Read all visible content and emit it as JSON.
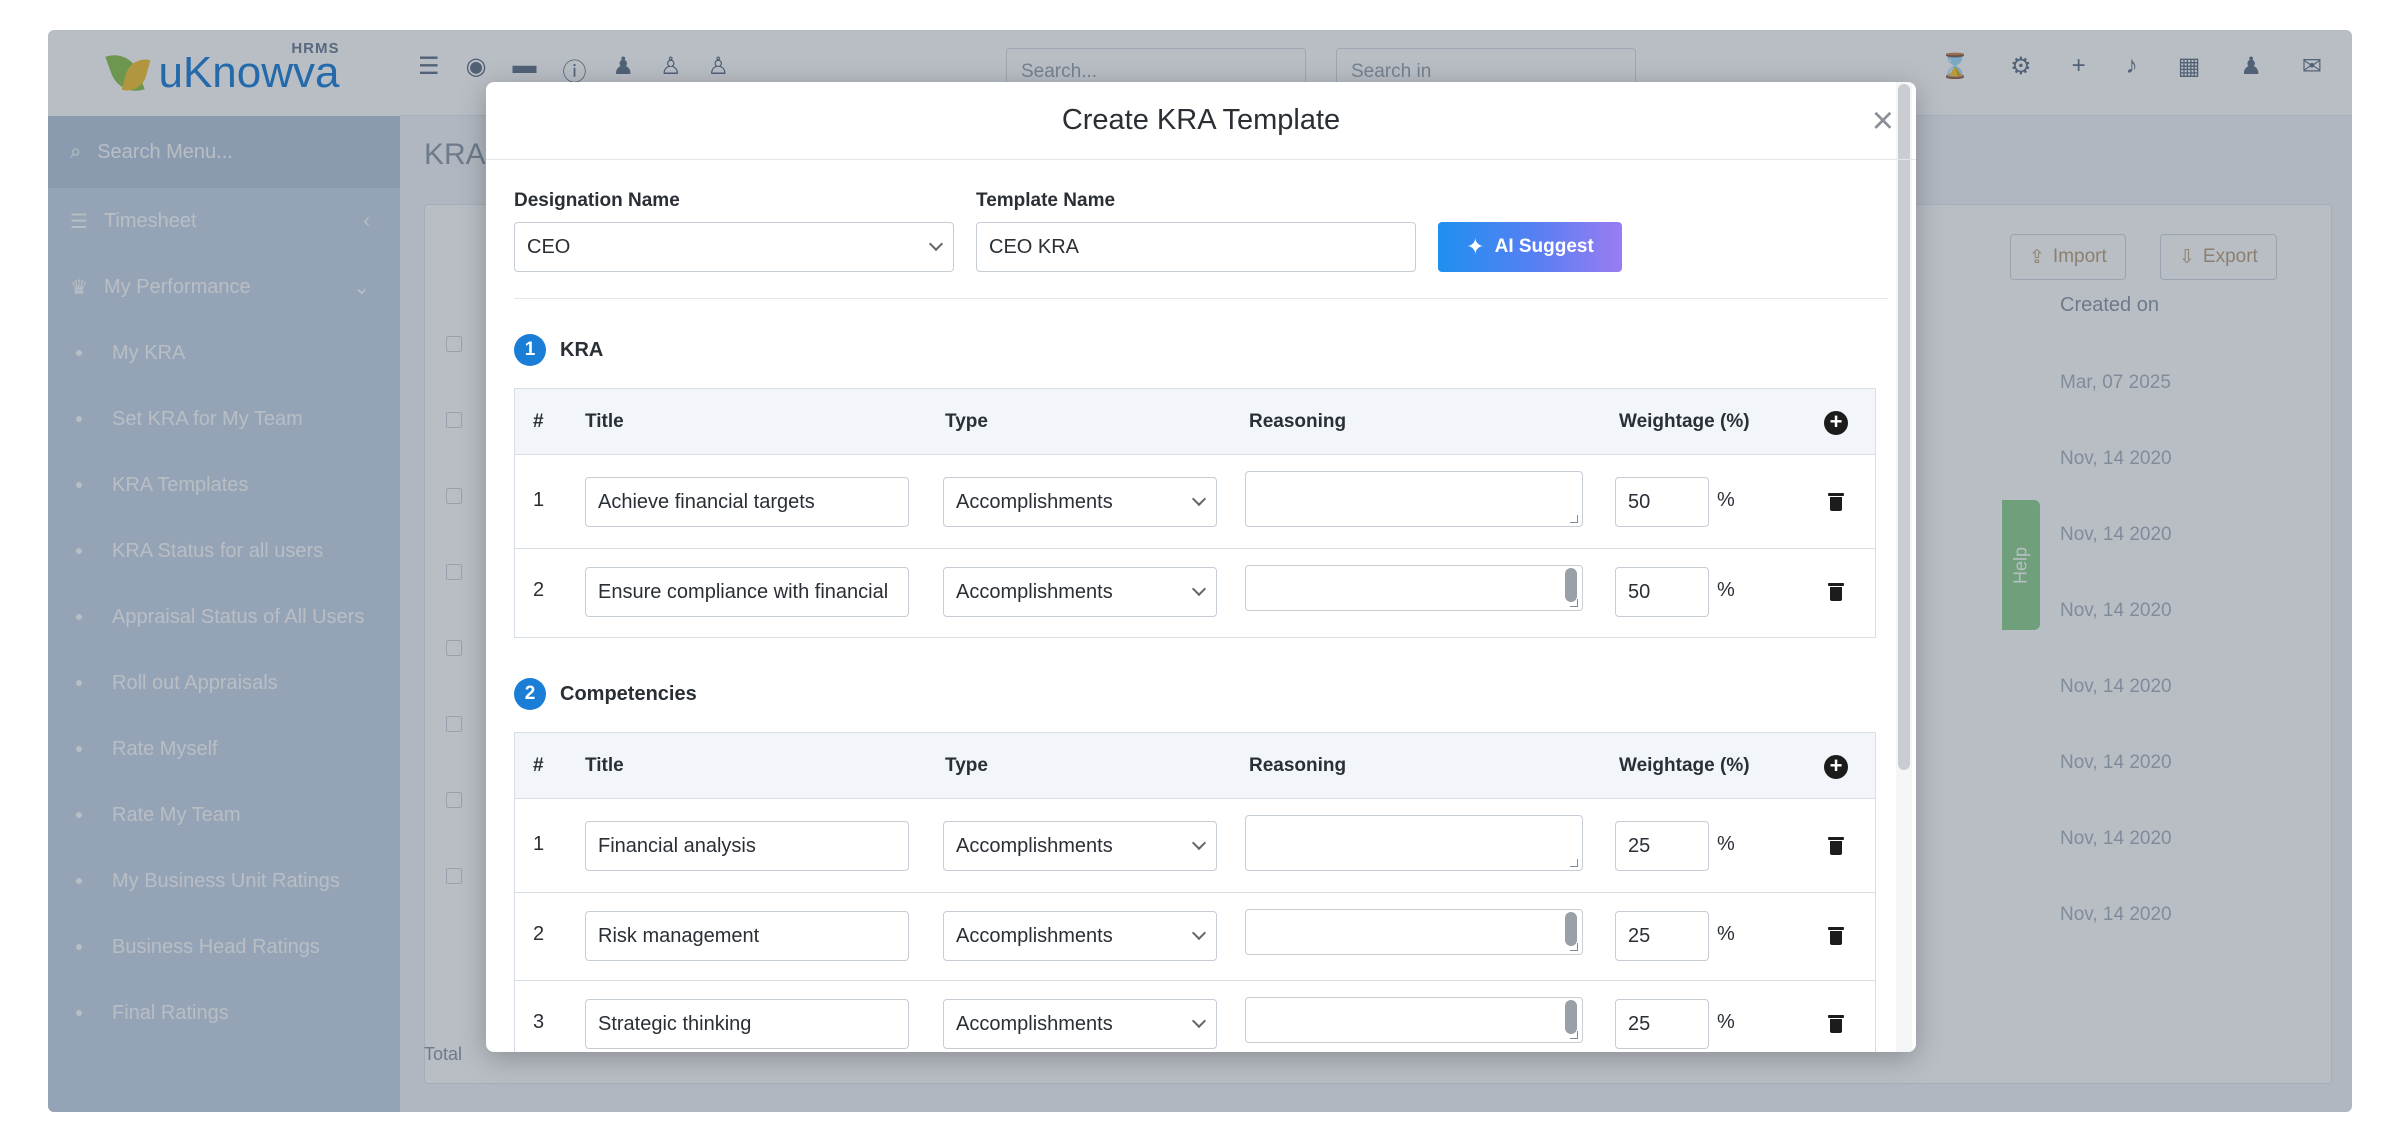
{
  "app": {
    "logo": {
      "brand": "uKnowva",
      "tag": "HRMS"
    },
    "topbar": {
      "search_placeholder": "Search...",
      "search_in_placeholder": "Search in"
    },
    "sidebar": {
      "search_label": "Search Menu...",
      "items": [
        {
          "label": "Timesheet",
          "icon": "list-icon",
          "chevron": "‹"
        },
        {
          "label": "My Performance",
          "icon": "trophy-icon",
          "chevron": "⌄"
        },
        {
          "label": "My KRA"
        },
        {
          "label": "Set KRA for My Team"
        },
        {
          "label": "KRA Templates"
        },
        {
          "label": "KRA Status for all users"
        },
        {
          "label": "Appraisal Status of All Users"
        },
        {
          "label": "Roll out Appraisals"
        },
        {
          "label": "Rate Myself"
        },
        {
          "label": "Rate My Team"
        },
        {
          "label": "My Business Unit Ratings"
        },
        {
          "label": "Business Head Ratings"
        },
        {
          "label": "Final Ratings"
        }
      ]
    },
    "background": {
      "page_heading": "KRA",
      "import_label": "Import",
      "export_label": "Export",
      "created_on_header": "Created on",
      "dates": [
        "Mar, 07 2025",
        "Nov, 14 2020",
        "Nov, 14 2020",
        "Nov, 14 2020",
        "Nov, 14 2020",
        "Nov, 14 2020",
        "Nov, 14 2020",
        "Nov, 14 2020"
      ],
      "total_label": "Total",
      "help_label": "Help"
    }
  },
  "modal": {
    "title": "Create KRA Template",
    "close_glyph": "×",
    "designation_label": "Designation Name",
    "designation_value": "CEO",
    "template_label": "Template Name",
    "template_value": "CEO KRA",
    "ai_button": "AI Suggest",
    "columns": {
      "num": "#",
      "title": "Title",
      "type": "Type",
      "reasoning": "Reasoning",
      "weightage": "Weightage (%)"
    },
    "percent_sign": "%",
    "sections": [
      {
        "step": "1",
        "name": "KRA",
        "rows": [
          {
            "num": "1",
            "title": "Achieve financial targets",
            "type": "Accomplishments",
            "reasoning": "",
            "weight": "50"
          },
          {
            "num": "2",
            "title": "Ensure compliance with financial",
            "type": "Accomplishments",
            "reasoning": "",
            "weight": "50"
          }
        ]
      },
      {
        "step": "2",
        "name": "Competencies",
        "rows": [
          {
            "num": "1",
            "title": "Financial analysis",
            "type": "Accomplishments",
            "reasoning": "",
            "weight": "25"
          },
          {
            "num": "2",
            "title": "Risk management",
            "type": "Accomplishments",
            "reasoning": "",
            "weight": "25"
          },
          {
            "num": "3",
            "title": "Strategic thinking",
            "type": "Accomplishments",
            "reasoning": "",
            "weight": "25"
          }
        ]
      }
    ]
  },
  "colors": {
    "accent": "#1b7ed6",
    "ai_gradient_start": "#1e90f0",
    "ai_gradient_end": "#9a7cf2",
    "sidebar": "#c7d6e6"
  }
}
